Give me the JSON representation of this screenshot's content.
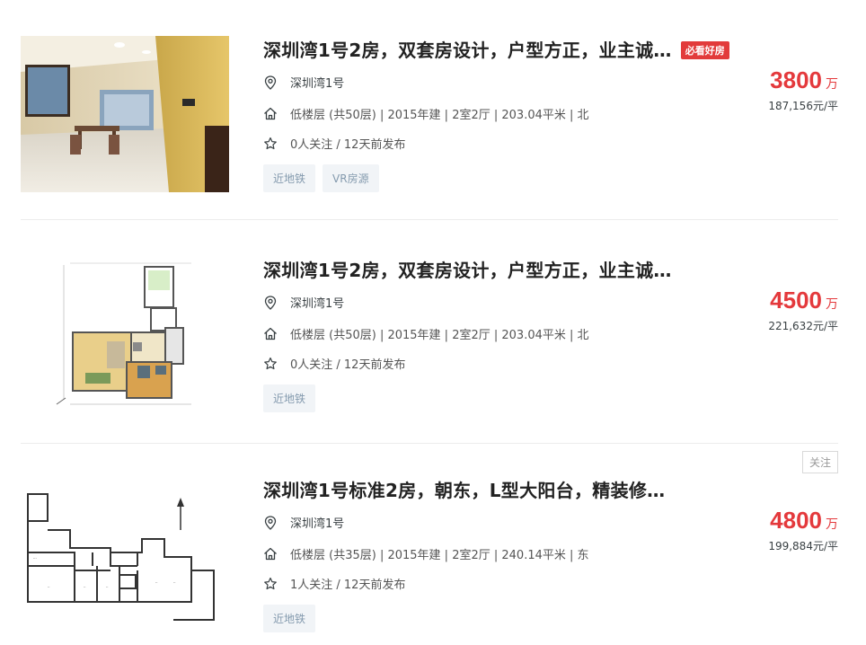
{
  "listings": [
    {
      "title": "深圳湾1号2房，双套房设计，户型方正，业主诚…",
      "badge": "必看好房",
      "community": "深圳湾1号",
      "house_info": "低楼层 (共50层) | 2015年建 | 2室2厅 | 203.04平米 | 北",
      "follow_info": "0人关注 / 12天前发布",
      "tags": [
        "近地铁",
        "VR房源"
      ],
      "total_price": "3800",
      "total_unit": "万",
      "unit_price": "187,156元/平",
      "photo": "living-room-photo"
    },
    {
      "title": "深圳湾1号2房，双套房设计，户型方正，业主诚…",
      "community": "深圳湾1号",
      "house_info": "低楼层 (共50层) | 2015年建 | 2室2厅 | 203.04平米 | 北",
      "follow_info": "0人关注 / 12天前发布",
      "tags": [
        "近地铁"
      ],
      "total_price": "4500",
      "total_unit": "万",
      "unit_price": "221,632元/平",
      "photo": "floor-plan-color"
    },
    {
      "title": "深圳湾1号标准2房，朝东，L型大阳台，精装修…",
      "follow_button": "关注",
      "community": "深圳湾1号",
      "house_info": "低楼层 (共35层) | 2015年建 | 2室2厅 | 240.14平米 | 东",
      "follow_info": "1人关注 / 12天前发布",
      "tags": [
        "近地铁"
      ],
      "total_price": "4800",
      "total_unit": "万",
      "unit_price": "199,884元/平",
      "photo": "floor-plan-line"
    }
  ],
  "colors": {
    "price": "#e4393c",
    "badge": "#e23b3b",
    "tag_bg": "#f1f4f7",
    "tag_text": "#849aae"
  },
  "icons": [
    "location-pin-icon",
    "house-icon",
    "star-icon"
  ]
}
